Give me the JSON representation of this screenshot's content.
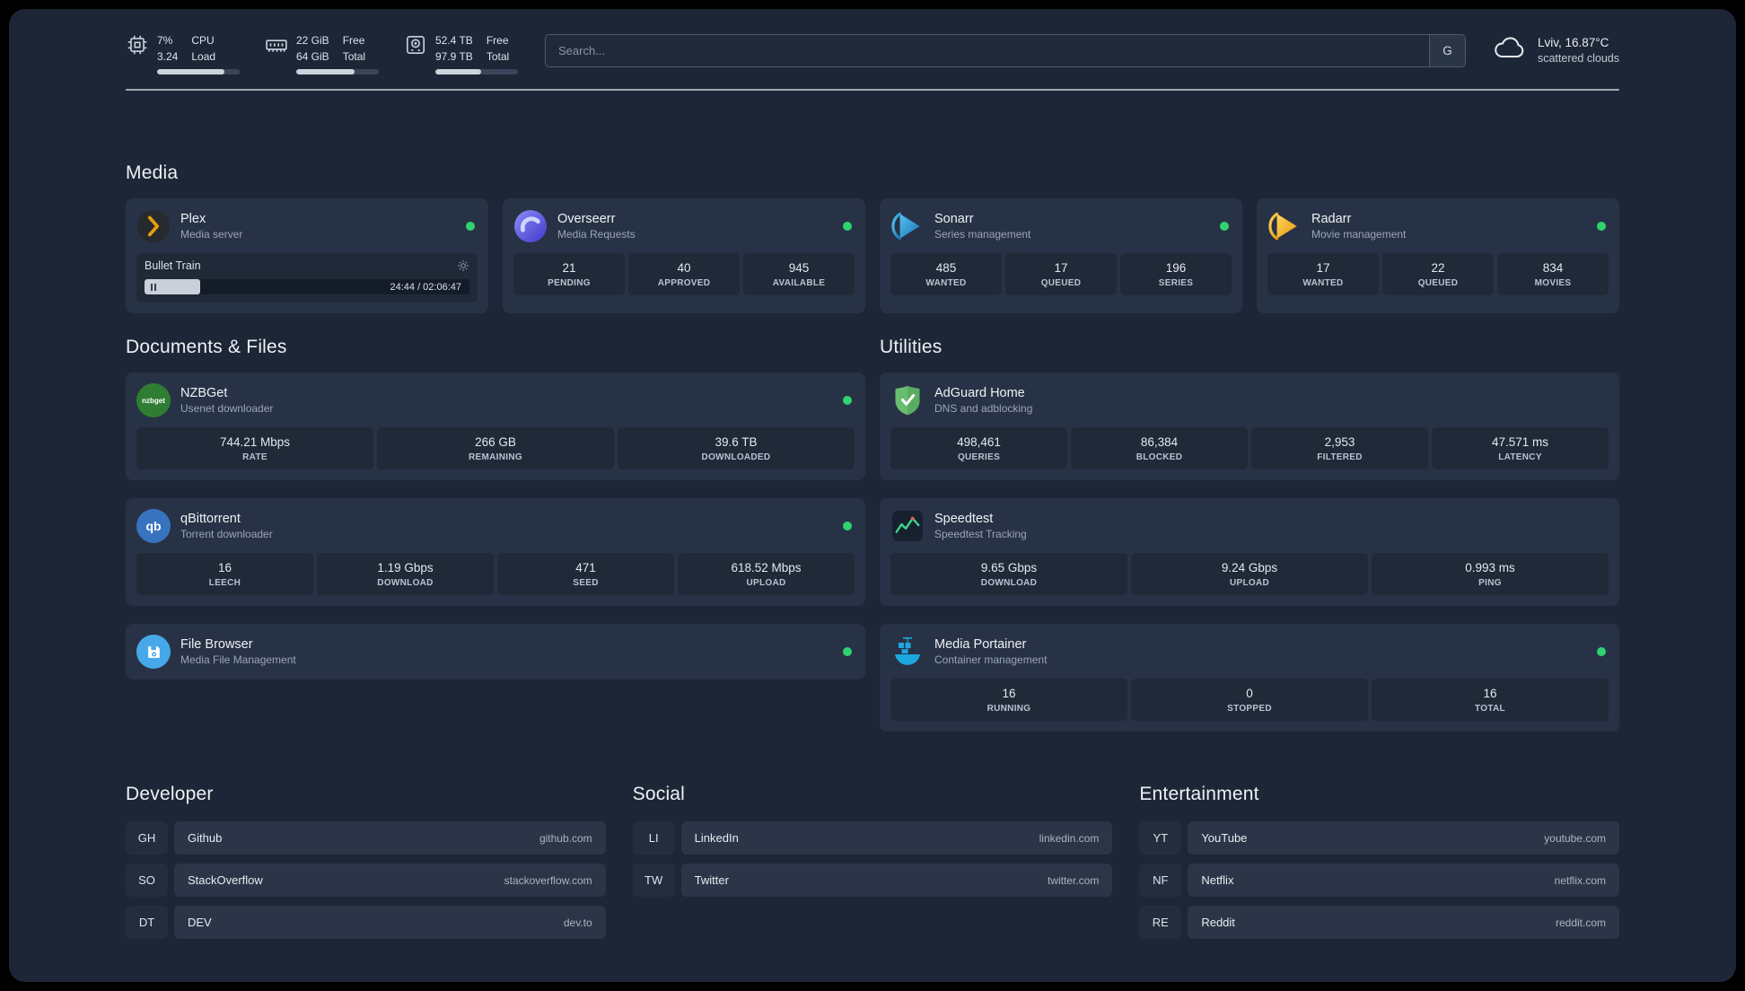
{
  "topbar": {
    "cpu": {
      "value1": "7%",
      "value2": "3.24",
      "label1": "CPU",
      "label2": "Load",
      "bar_style": "width:82%"
    },
    "memory": {
      "value1": "22 GiB",
      "value2": "64 GiB",
      "label1": "Free",
      "label2": "Total",
      "bar_style": "width:71%"
    },
    "disk": {
      "value1": "52.4 TB",
      "value2": "97.9 TB",
      "label1": "Free",
      "label2": "Total",
      "bar_style": "width:55%"
    },
    "search": {
      "placeholder": "Search...",
      "button_label": "G"
    },
    "weather": {
      "location": "Lviv, 16.87°C",
      "condition": "scattered clouds"
    }
  },
  "media": {
    "title": "Media",
    "plex": {
      "name": "Plex",
      "desc": "Media server",
      "now_playing": "Bullet Train",
      "time": "24:44 / 02:06:47",
      "progress_style": "width:17%"
    },
    "overseerr": {
      "name": "Overseerr",
      "desc": "Media Requests",
      "stats": [
        {
          "value": "21",
          "label": "PENDING"
        },
        {
          "value": "40",
          "label": "APPROVED"
        },
        {
          "value": "945",
          "label": "AVAILABLE"
        }
      ]
    },
    "sonarr": {
      "name": "Sonarr",
      "desc": "Series management",
      "stats": [
        {
          "value": "485",
          "label": "WANTED"
        },
        {
          "value": "17",
          "label": "QUEUED"
        },
        {
          "value": "196",
          "label": "SERIES"
        }
      ]
    },
    "radarr": {
      "name": "Radarr",
      "desc": "Movie management",
      "stats": [
        {
          "value": "17",
          "label": "WANTED"
        },
        {
          "value": "22",
          "label": "QUEUED"
        },
        {
          "value": "834",
          "label": "MOVIES"
        }
      ]
    }
  },
  "documents": {
    "title": "Documents & Files",
    "nzbget": {
      "name": "NZBGet",
      "desc": "Usenet downloader",
      "icon_text": "nzbget",
      "stats": [
        {
          "value": "744.21 Mbps",
          "label": "RATE"
        },
        {
          "value": "266 GB",
          "label": "REMAINING"
        },
        {
          "value": "39.6 TB",
          "label": "DOWNLOADED"
        }
      ]
    },
    "qbittorrent": {
      "name": "qBittorrent",
      "desc": "Torrent downloader",
      "icon_text": "qb",
      "stats": [
        {
          "value": "16",
          "label": "LEECH"
        },
        {
          "value": "1.19 Gbps",
          "label": "DOWNLOAD"
        },
        {
          "value": "471",
          "label": "SEED"
        },
        {
          "value": "618.52 Mbps",
          "label": "UPLOAD"
        }
      ]
    },
    "filebrowser": {
      "name": "File Browser",
      "desc": "Media File Management"
    }
  },
  "utilities": {
    "title": "Utilities",
    "adguard": {
      "name": "AdGuard Home",
      "desc": "DNS and adblocking",
      "stats": [
        {
          "value": "498,461",
          "label": "QUERIES"
        },
        {
          "value": "86,384",
          "label": "BLOCKED"
        },
        {
          "value": "2,953",
          "label": "FILTERED"
        },
        {
          "value": "47.571 ms",
          "label": "LATENCY"
        }
      ]
    },
    "speedtest": {
      "name": "Speedtest",
      "desc": "Speedtest Tracking",
      "stats": [
        {
          "value": "9.65 Gbps",
          "label": "DOWNLOAD"
        },
        {
          "value": "9.24 Gbps",
          "label": "UPLOAD"
        },
        {
          "value": "0.993 ms",
          "label": "PING"
        }
      ]
    },
    "portainer": {
      "name": "Media Portainer",
      "desc": "Container management",
      "stats": [
        {
          "value": "16",
          "label": "RUNNING"
        },
        {
          "value": "0",
          "label": "STOPPED"
        },
        {
          "value": "16",
          "label": "TOTAL"
        }
      ]
    }
  },
  "bookmarks": {
    "developer": {
      "title": "Developer",
      "items": [
        {
          "abbr": "GH",
          "name": "Github",
          "url": "github.com"
        },
        {
          "abbr": "SO",
          "name": "StackOverflow",
          "url": "stackoverflow.com"
        },
        {
          "abbr": "DT",
          "name": "DEV",
          "url": "dev.to"
        }
      ]
    },
    "social": {
      "title": "Social",
      "items": [
        {
          "abbr": "LI",
          "name": "LinkedIn",
          "url": "linkedin.com"
        },
        {
          "abbr": "TW",
          "name": "Twitter",
          "url": "twitter.com"
        }
      ]
    },
    "entertainment": {
      "title": "Entertainment",
      "items": [
        {
          "abbr": "YT",
          "name": "YouTube",
          "url": "youtube.com"
        },
        {
          "abbr": "NF",
          "name": "Netflix",
          "url": "netflix.com"
        },
        {
          "abbr": "RE",
          "name": "Reddit",
          "url": "reddit.com"
        }
      ]
    }
  }
}
